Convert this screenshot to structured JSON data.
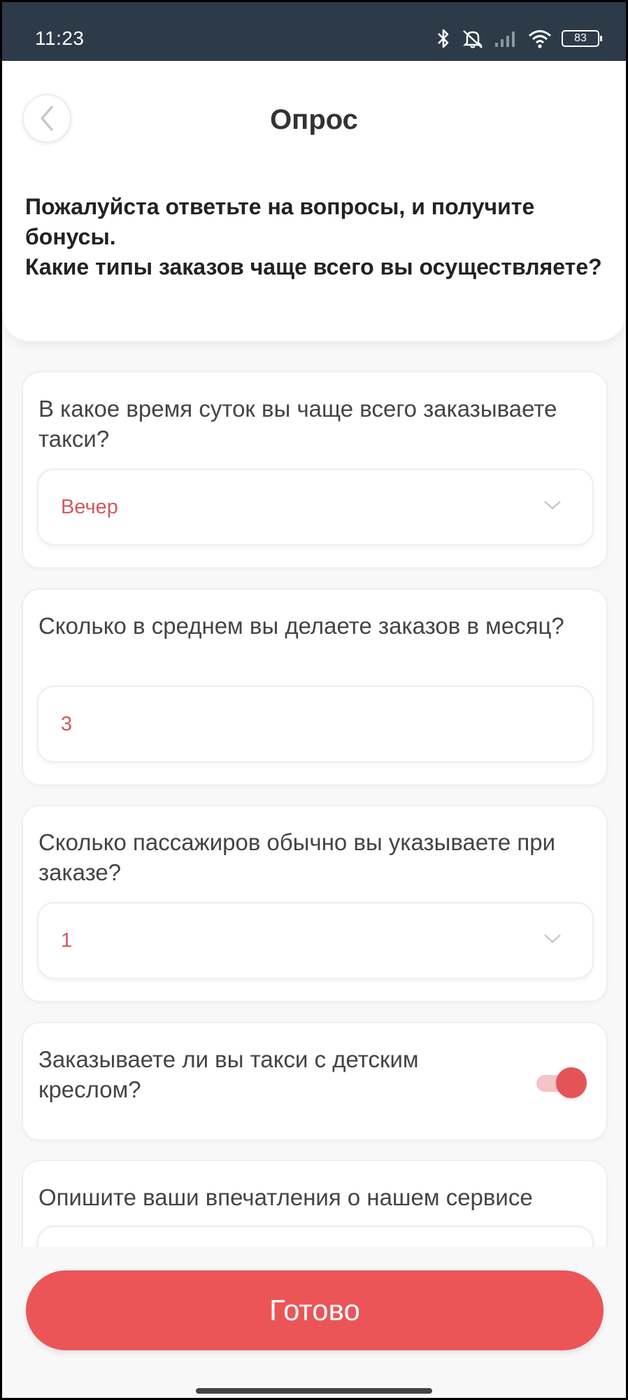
{
  "status_bar": {
    "time": "11:23",
    "battery": "83",
    "icons": [
      "bluetooth-icon",
      "mute-icon",
      "signal-icon",
      "wifi-icon",
      "battery-icon"
    ]
  },
  "header": {
    "title": "Опрос",
    "back_icon": "chevron-left-icon",
    "intro_line1": "Пожалуйста ответьте на вопросы, и получите бонусы.",
    "intro_line2": "Какие типы заказов чаще всего вы осуществляете?"
  },
  "questions": [
    {
      "label": "В какое время суток вы чаще всего заказываете такси?",
      "value": "Вечер",
      "type": "select"
    },
    {
      "label": "Сколько в среднем вы делаете заказов в месяц?",
      "value": "3",
      "type": "input"
    },
    {
      "label": "Сколько пассажиров обычно вы указываете при заказе?",
      "value": "1",
      "type": "select"
    },
    {
      "label": "Заказываете ли вы такси с детским креслом?",
      "value": true,
      "type": "toggle"
    },
    {
      "label": "Опишите ваши впечатления о нашем сервисе",
      "value": "",
      "type": "textarea"
    }
  ],
  "done_label": "Готово",
  "colors": {
    "accent": "#eb5558",
    "value_text": "#d6575a",
    "status_bar": "#2d3a48",
    "background": "#f8f8f8"
  }
}
